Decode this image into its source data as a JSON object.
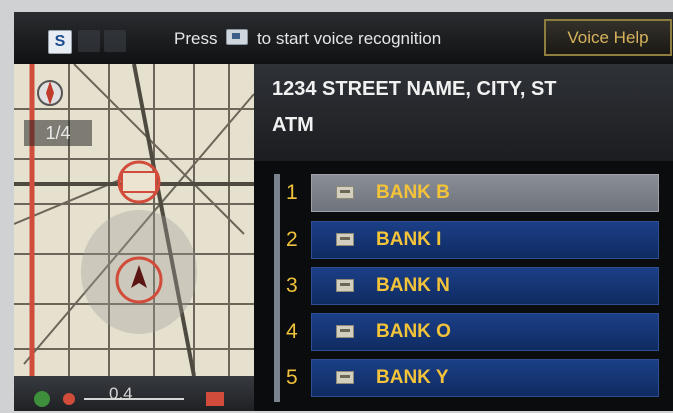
{
  "header": {
    "voice_prefix": "Press",
    "voice_suffix": "to start voice recognition",
    "voice_help_label": "Voice Help",
    "icons": [
      "navigation-icon",
      "phone-icon",
      "info-icon",
      "talk-button-icon"
    ]
  },
  "map": {
    "scale_top": "1/4",
    "scale_bottom": "0.4",
    "icons": [
      "compass-icon",
      "vehicle-position-icon",
      "destination-flag-icon",
      "route-start-icon"
    ],
    "colors": {
      "route": "#d24c3b",
      "road": "#6c665a",
      "land": "#e6e0cf"
    }
  },
  "address": {
    "line1": "1234 STREET NAME, CITY, ST",
    "line2": "ATM"
  },
  "results": {
    "selected_index": 0,
    "items": [
      {
        "num": "1",
        "label": "BANK B"
      },
      {
        "num": "2",
        "label": "BANK I"
      },
      {
        "num": "3",
        "label": "BANK N"
      },
      {
        "num": "4",
        "label": "BANK O"
      },
      {
        "num": "5",
        "label": "BANK Y"
      }
    ],
    "colors": {
      "text": "#f3c33a",
      "row": "#1b3f87",
      "selected": "#8a8e97"
    }
  }
}
